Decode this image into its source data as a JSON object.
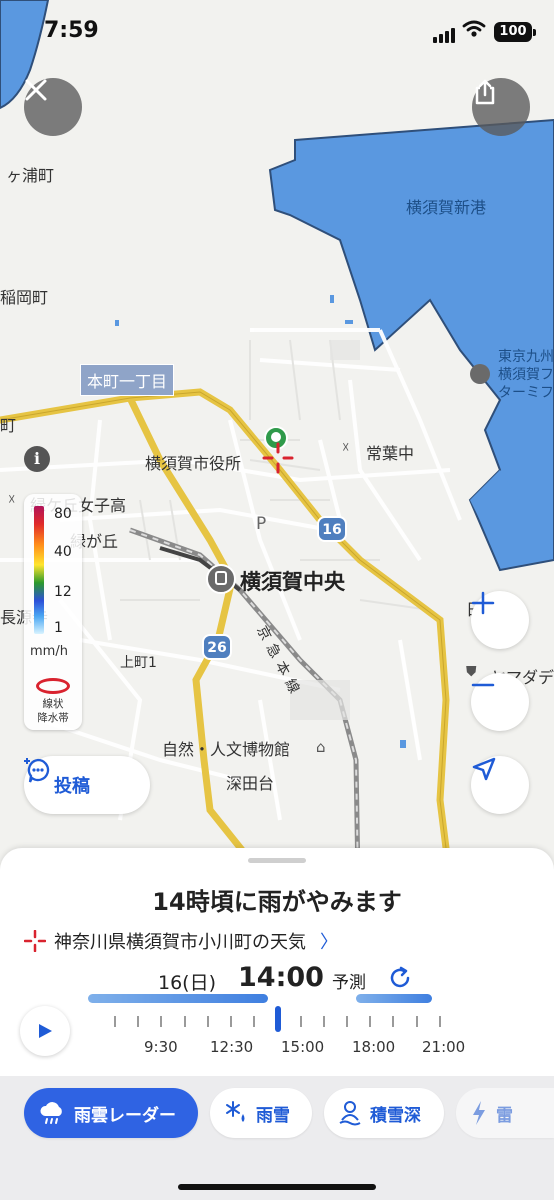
{
  "status": {
    "time": "7:59",
    "battery": "100"
  },
  "map": {
    "labels": {
      "ura": "ヶ浦町",
      "inaoka": "稲岡町",
      "shinko": "横須賀新港",
      "tokyo_line1": "東京九州",
      "tokyo_line2": "横須賀フ",
      "tokyo_line3": "ターミフ",
      "honcho": "本町一丁目",
      "machi": "町",
      "city_hall": "横須賀市役所",
      "tokiwa": "常葉中",
      "midorigaoka_school": "緑ケ丘女子高",
      "midorigaoka": "緑が丘",
      "chogenji": "長源寺",
      "station": "横須賀中央",
      "keikyu": "京急本線",
      "kamimachi": "上町1",
      "museum": "自然・人文博物館",
      "fukadadai": "深田台",
      "yamada": "ヤマダデ",
      "hi": "日"
    },
    "routes": {
      "r16": "16",
      "r26": "26"
    },
    "parking": "P"
  },
  "legend": {
    "values": [
      "80",
      "40",
      "12",
      "1"
    ],
    "unit": "mm/h",
    "band_line1": "線状",
    "band_line2": "降水帯"
  },
  "post_button": {
    "label": "投稿"
  },
  "sheet": {
    "title": "14時頃に雨がやみます",
    "location": "神奈川県横須賀市小川町の天気",
    "date": "16(日)",
    "time": "14:00",
    "mode": "予測",
    "timeline_labels": [
      "9:30",
      "12:30",
      "15:00",
      "18:00",
      "21:00"
    ]
  },
  "tabs": [
    {
      "label": "雨雲レーダー",
      "icon": "rain-cloud-icon",
      "active": true
    },
    {
      "label": "雨雪",
      "icon": "snow-rain-icon",
      "active": false
    },
    {
      "label": "積雪深",
      "icon": "snow-depth-icon",
      "active": false
    },
    {
      "label": "雷",
      "icon": "lightning-icon",
      "active": false
    }
  ],
  "colors": {
    "accent": "#2f63e3",
    "road": "#e6c443",
    "water": "#5a98e0",
    "rain_band": "#d9232f"
  }
}
